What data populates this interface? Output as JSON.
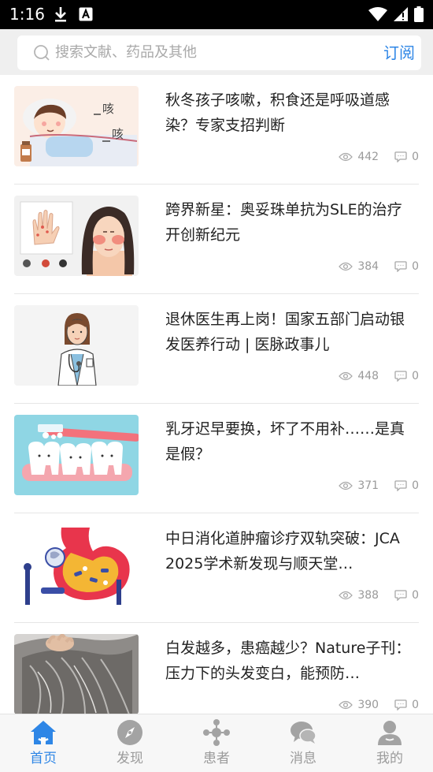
{
  "status_bar": {
    "time": "1:16"
  },
  "search": {
    "placeholder": "搜索文献、药品及其他",
    "subscribe_label": "订阅"
  },
  "articles": [
    {
      "title": "秋冬孩子咳嗽，积食还是呼吸道感染？专家支招判断",
      "views": "442",
      "comments": "0",
      "thumb_text_1": "咳",
      "thumb_text_2": "咳",
      "thumb_icon": "child-cough-illustration"
    },
    {
      "title": "跨界新星：奥妥珠单抗为SLE的治疗开创新纪元",
      "views": "384",
      "comments": "0",
      "thumb_icon": "lupus-rash-illustration"
    },
    {
      "title": "退休医生再上岗！国家五部门启动银发医养行动 | 医脉政事儿",
      "views": "448",
      "comments": "0",
      "thumb_icon": "doctor-illustration"
    },
    {
      "title": "乳牙迟早要换，坏了不用补……是真是假？",
      "views": "371",
      "comments": "0",
      "thumb_icon": "teeth-toothbrush-illustration"
    },
    {
      "title": "中日消化道肿瘤诊疗双轨突破：JCA 2025学术新发现与顺天堂…",
      "views": "388",
      "comments": "0",
      "thumb_icon": "stomach-illustration"
    },
    {
      "title": "白发越多，患癌越少？Nature子刊：压力下的头发变白，能预防…",
      "views": "390",
      "comments": "0",
      "thumb_icon": "gray-hair-photo"
    }
  ],
  "bottom_nav": [
    {
      "label": "首页",
      "icon": "home-icon",
      "active": true
    },
    {
      "label": "发现",
      "icon": "compass-icon",
      "active": false
    },
    {
      "label": "患者",
      "icon": "patients-icon",
      "active": false
    },
    {
      "label": "消息",
      "icon": "chat-icon",
      "active": false
    },
    {
      "label": "我的",
      "icon": "profile-icon",
      "active": false
    }
  ],
  "colors": {
    "accent": "#2e86e6",
    "inactive": "#9b9b9b",
    "header_bg": "#efefef"
  }
}
